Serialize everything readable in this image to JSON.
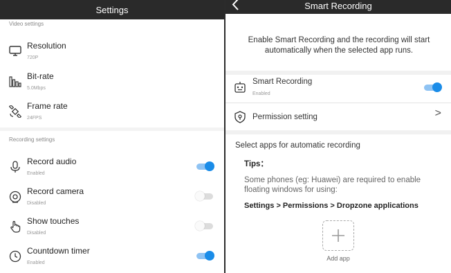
{
  "colors": {
    "accent": "#1a8ce8",
    "topbar": "#2a2a2a"
  },
  "left": {
    "title": "Settings",
    "video_section": "Video settings",
    "recording_section": "Recording settings",
    "items": [
      {
        "icon": "monitor-icon",
        "title": "Resolution",
        "sub": "720P"
      },
      {
        "icon": "bitrate-icon",
        "title": "Bit-rate",
        "sub": "5.0Mbps"
      },
      {
        "icon": "satellite-icon",
        "title": "Frame rate",
        "sub": "24FPS"
      },
      {
        "icon": "microphone-icon",
        "title": "Record audio",
        "sub": "Enabled",
        "toggle": "on"
      },
      {
        "icon": "camera-icon",
        "title": "Record camera",
        "sub": "Disabled",
        "toggle": "off"
      },
      {
        "icon": "hand-touch-icon",
        "title": "Show touches",
        "sub": "Disabled",
        "toggle": "off"
      },
      {
        "icon": "clock-icon",
        "title": "Countdown timer",
        "sub": "Enabled",
        "toggle": "on"
      }
    ]
  },
  "right": {
    "title": "Smart Recording",
    "intro": "Enable Smart Recording and the recording will start automatically when the selected app runs.",
    "smart": {
      "title": "Smart Recording",
      "sub": "Enabled",
      "toggle": "on"
    },
    "permission": {
      "title": "Permission setting",
      "chevron": ">"
    },
    "select_label": "Select apps for automatic recording",
    "tips_title": "Tips：",
    "tips_body": "Some phones (eg: Huawei) are required to enable floating windows for using:",
    "tips_path": "Settings > Permissions > Dropzone applications",
    "add_app": "Add app"
  }
}
